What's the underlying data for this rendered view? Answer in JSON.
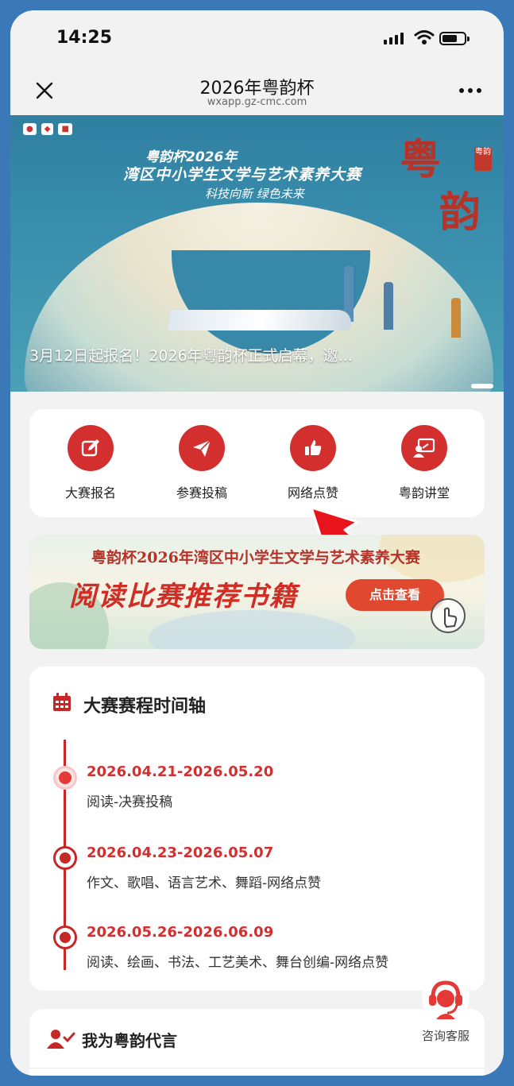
{
  "status_bar": {
    "time": "14:25"
  },
  "nav": {
    "title": "2026年粤韵杯",
    "subtitle": "wxapp.gz-cmc.com"
  },
  "banner": {
    "title_line1": "粤韵杯2026年",
    "title_line2": "湾区中小学生文学与艺术素养大赛",
    "slogan": "科技向新 绿色未来",
    "brand": "粤",
    "brand2": "韵",
    "seal": "粤韵",
    "caption": "3月12日起报名！2026年粤韵杯正式启幕，邀..."
  },
  "quick_menu": [
    {
      "label": "大赛报名",
      "icon": "edit-icon"
    },
    {
      "label": "参赛投稿",
      "icon": "paper-plane-icon"
    },
    {
      "label": "网络点赞",
      "icon": "thumbs-up-icon"
    },
    {
      "label": "粤韵讲堂",
      "icon": "lecture-icon"
    }
  ],
  "book_banner": {
    "title": "粤韵杯2026年湾区中小学生文学与艺术素养大赛",
    "headline": "阅读比赛推荐书籍",
    "button": "点击查看"
  },
  "timeline": {
    "title": "大赛赛程时间轴",
    "items": [
      {
        "date": "2026.04.21-2026.05.20",
        "text": "阅读-决赛投稿",
        "active": true
      },
      {
        "date": "2026.04.23-2026.05.07",
        "text": "作文、歌唱、语言艺术、舞蹈-网络点赞",
        "active": false
      },
      {
        "date": "2026.05.26-2026.06.09",
        "text": "阅读、绘画、书法、工艺美术、舞台创编-网络点赞",
        "active": false
      }
    ]
  },
  "ambassador": {
    "title": "我为粤韵代言"
  },
  "customer_service": {
    "label": "咨询客服"
  },
  "colors": {
    "accent": "#d32f2f",
    "page_bg": "#f2f2f2",
    "frame": "#3a78b8"
  }
}
